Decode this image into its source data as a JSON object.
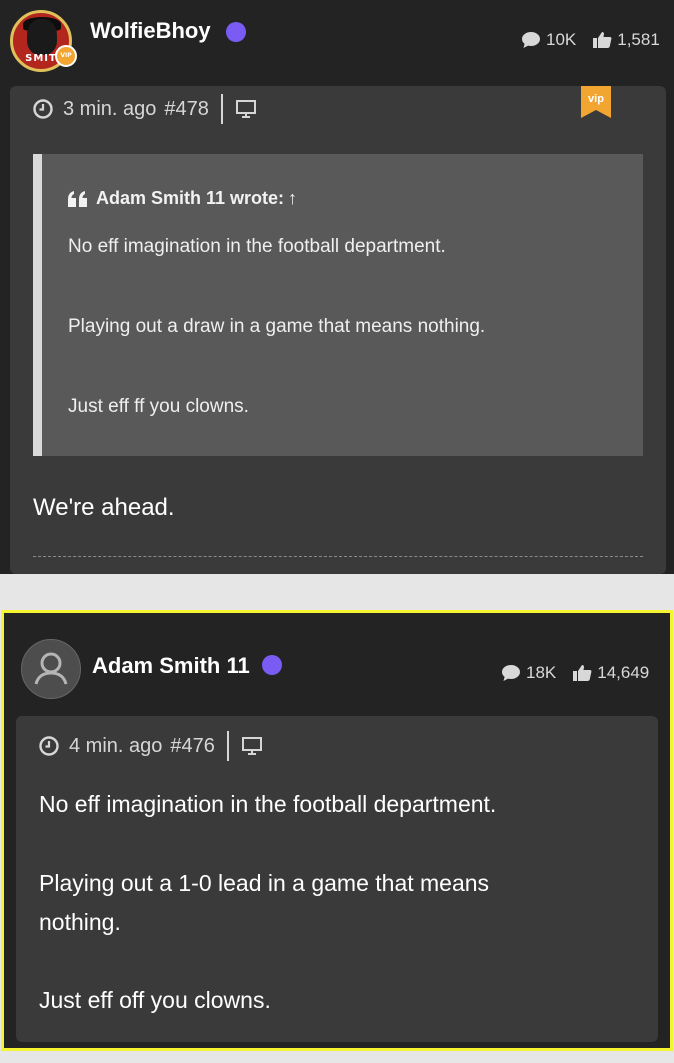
{
  "post1": {
    "username": "WolfieBhoy",
    "avatar_text": "SMIT",
    "vip_badge": "VIP",
    "posts_count": "10K",
    "likes_count": "1,581",
    "time": "3 min. ago",
    "post_number": "#478",
    "quote": {
      "author_line": "Adam Smith 11 wrote:",
      "arrow": "↑",
      "lines": [
        "No eff imagination in the football department.",
        "Playing out a draw in a game that means nothing.",
        "Just eff ff you clowns."
      ]
    },
    "body": "We're ahead."
  },
  "post2": {
    "username": "Adam Smith 11",
    "posts_count": "18K",
    "likes_count": "14,649",
    "time": "4 min. ago",
    "post_number": "#476",
    "lines": [
      "No eff imagination in the football department.",
      "Playing out a 1-0 lead in a game that means",
      "nothing.",
      "Just eff off you clowns."
    ]
  },
  "colors": {
    "online_dot": "#7a5cf5",
    "highlight_border": "#f4f433",
    "vip_gold": "#f3a531"
  }
}
